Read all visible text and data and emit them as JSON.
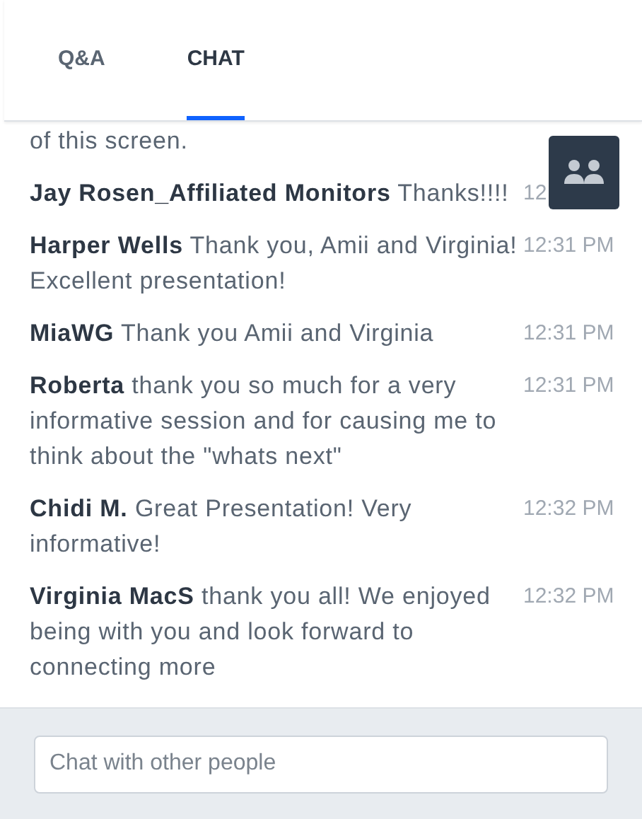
{
  "tabs": [
    {
      "label": "Q&A",
      "selected": false
    },
    {
      "label": "CHAT",
      "selected": true
    }
  ],
  "previous_message_tail": "of this screen.",
  "messages": [
    {
      "author": "Jay Rosen_Affiliated Monitors",
      "text": "Thanks!!!!",
      "time": "12"
    },
    {
      "author": "Harper Wells",
      "text": "Thank you, Amii and Virginia! Excellent presentation!",
      "time": "12:31 PM"
    },
    {
      "author": "MiaWG",
      "text": "Thank you Amii and Virginia",
      "time": "12:31 PM"
    },
    {
      "author": "Roberta",
      "text": "thank you so much for a very informative session and for causing me to think about the \"whats next\"",
      "time": "12:31 PM"
    },
    {
      "author": "Chidi M.",
      "text": "Great Presentation! Very informative!",
      "time": "12:32 PM"
    },
    {
      "author": "Virginia MacS",
      "text": "thank you all! We enjoyed being with you and look forward to connecting more",
      "time": "12:32 PM"
    }
  ],
  "chat_input": {
    "placeholder": "Chat with other people"
  }
}
